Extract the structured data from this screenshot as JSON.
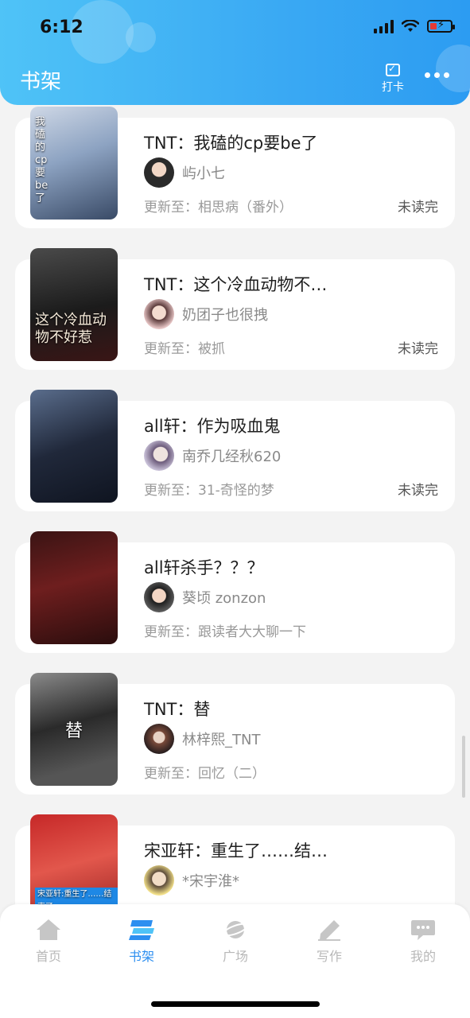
{
  "status": {
    "time": "6:12"
  },
  "header": {
    "title": "书架",
    "checkin_label": "打卡"
  },
  "books": [
    {
      "title": "TNT：我磕的cp要be了",
      "author": "屿小七",
      "update": "更新至：相思病（番外）",
      "status": "未读完",
      "cover_text": "我磕的cp要be了"
    },
    {
      "title": "TNT：这个冷血动物不…",
      "author": "奶团子也很拽",
      "update": "更新至：被抓",
      "status": "未读完",
      "cover_text": "这个冷血动物不好惹"
    },
    {
      "title": "all轩：作为吸血鬼",
      "author": "南乔几经秋620",
      "update": "更新至：31-奇怪的梦",
      "status": "未读完",
      "cover_text": ""
    },
    {
      "title": "all轩杀手？？？",
      "author": "葵顷 zonzon",
      "update": "更新至：跟读者大大聊一下",
      "status": "",
      "cover_text": ""
    },
    {
      "title": "TNT：替",
      "author": "林梓熙_TNT",
      "update": "更新至：回忆（二）",
      "status": "",
      "cover_text": "替"
    },
    {
      "title": "宋亚轩：重生了……结…",
      "author": "*宋宇淮*",
      "update": "",
      "status": "",
      "cover_text": "宋亚轩:重生了……结束了"
    }
  ],
  "tabs": [
    {
      "label": "首页",
      "icon": "home-icon"
    },
    {
      "label": "书架",
      "icon": "bookshelf-icon"
    },
    {
      "label": "广场",
      "icon": "planet-icon"
    },
    {
      "label": "写作",
      "icon": "pen-icon"
    },
    {
      "label": "我的",
      "icon": "chat-bubble-icon"
    }
  ],
  "colors": {
    "accent": "#2d8ff0",
    "header_start": "#4fc3f7",
    "header_end": "#2c9cf2"
  }
}
